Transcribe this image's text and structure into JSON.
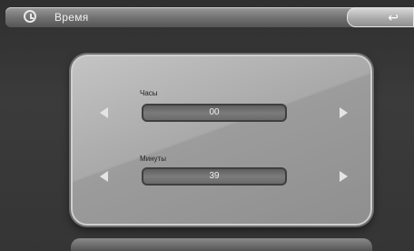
{
  "header": {
    "title": "Время",
    "back_icon": "undo-arrow-icon",
    "clock_icon": "clock-icon"
  },
  "hours": {
    "label": "Часы",
    "value": "00"
  },
  "minutes": {
    "label": "Минуты",
    "value": "39"
  }
}
